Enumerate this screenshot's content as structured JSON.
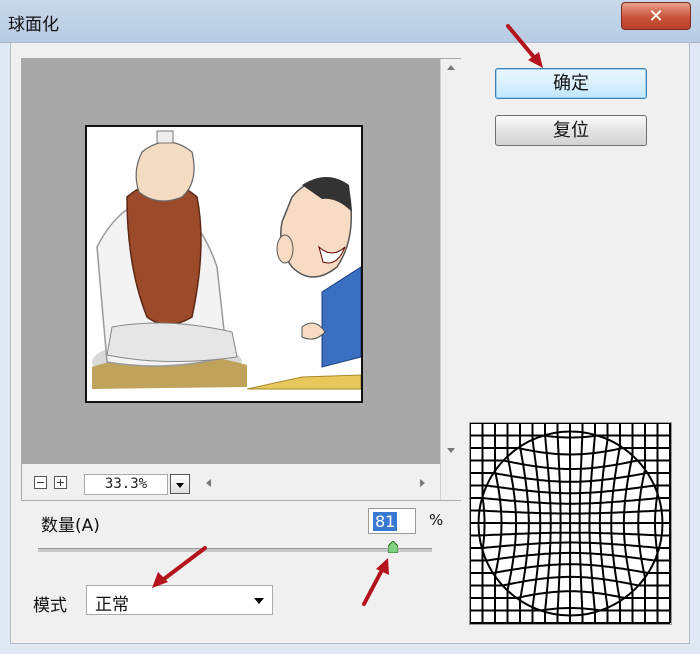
{
  "window": {
    "title": "球面化",
    "close_glyph": "✕"
  },
  "preview": {
    "zoom_level": "33.3%",
    "zoom_out_glyph": "−",
    "zoom_in_glyph": "+"
  },
  "buttons": {
    "ok_label": "确定",
    "reset_label": "复位"
  },
  "amount": {
    "label": "数量(A)",
    "value": "81",
    "unit": "%",
    "slider_fraction": 0.9
  },
  "mode": {
    "label": "模式",
    "selected": "正常"
  },
  "colors": {
    "annotation_arrow": "#b3141c",
    "selection": "#3a79d2",
    "title_bar": "#c9d8ea"
  }
}
